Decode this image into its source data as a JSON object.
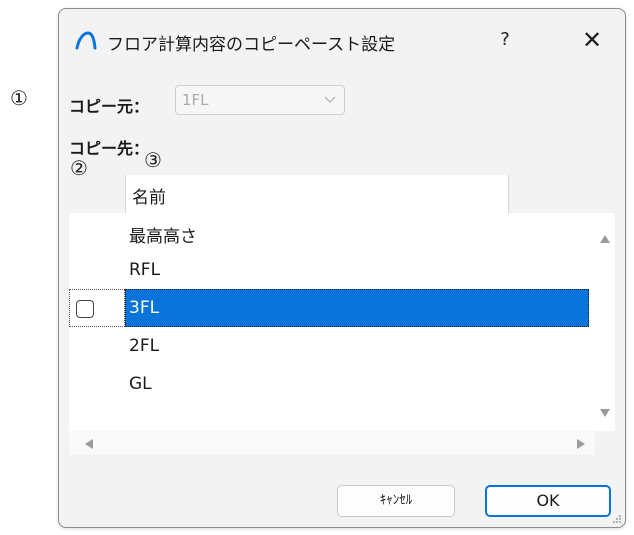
{
  "callouts": {
    "c1": "①",
    "c2": "②",
    "c3": "③"
  },
  "dialog": {
    "title": "フロア計算内容のコピーペースト設定",
    "help_label": "?",
    "close_label": "✕",
    "app_icon": "app-logo-icon"
  },
  "copy_source": {
    "label": "コピー元：",
    "value": "1FL"
  },
  "copy_dest": {
    "label": "コピー先："
  },
  "table": {
    "column_header": "名前",
    "rows": [
      "最高高さ",
      "RFL",
      "3FL",
      "2FL",
      "GL"
    ],
    "selected_index": 2
  },
  "buttons": {
    "cancel": "ｷｬﾝｾﾙ",
    "ok": "OK"
  },
  "colors": {
    "accent": "#0a74da"
  }
}
